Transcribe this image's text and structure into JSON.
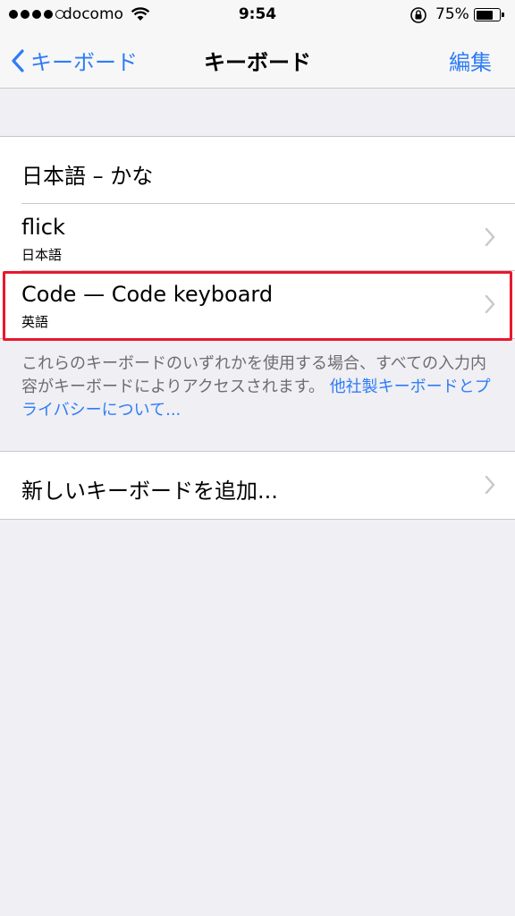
{
  "status_bar": {
    "carrier": "docomo",
    "time": "9:54",
    "battery_percent": "75%",
    "battery_level": 0.75,
    "signal_dots_filled": 4
  },
  "nav": {
    "back_label": "キーボード",
    "title": "キーボード",
    "edit_label": "編集"
  },
  "keyboards": [
    {
      "title": "日本語 – かな"
    },
    {
      "title": "flick",
      "subtitle": "日本語"
    },
    {
      "title": "Code — Code keyboard",
      "subtitle": "英語"
    }
  ],
  "footer": {
    "text": "これらのキーボードのいずれかを使用する場合、すべての入力内容がキーボードによりアクセスされます。",
    "link": "他社製キーボードとプライバシーについて..."
  },
  "add_keyboard": {
    "label": "新しいキーボードを追加..."
  },
  "colors": {
    "accent": "#2f7cf6",
    "highlight": "#e8182f",
    "background": "#efeff4"
  },
  "icons": [
    "wifi-icon",
    "rotation-lock-icon",
    "battery-icon",
    "back-chevron-icon",
    "chevron-right-icon"
  ]
}
